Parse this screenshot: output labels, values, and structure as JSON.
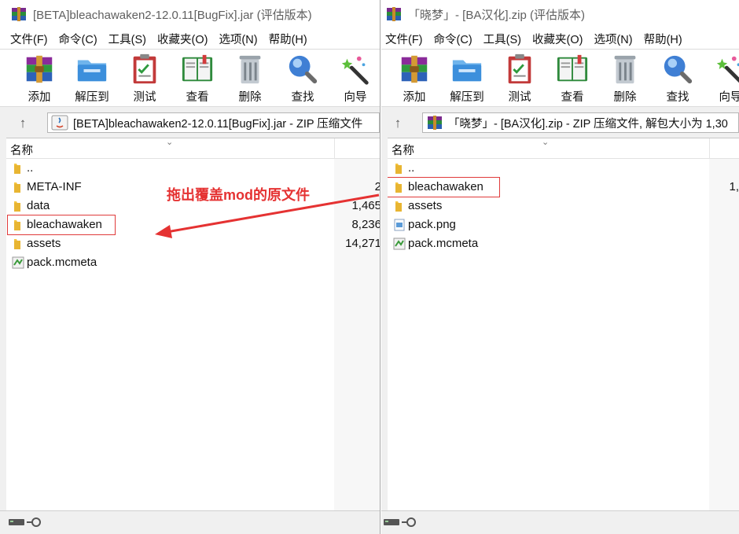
{
  "left": {
    "title": "[BETA]bleachawaken2-12.0.11[BugFix].jar (评估版本)",
    "menu": [
      "文件(F)",
      "命令(C)",
      "工具(S)",
      "收藏夹(O)",
      "选项(N)",
      "帮助(H)"
    ],
    "toolbar": [
      {
        "label": "添加",
        "icon": "add-archive-icon"
      },
      {
        "label": "解压到",
        "icon": "extract-folder-icon"
      },
      {
        "label": "测试",
        "icon": "test-clipboard-icon"
      },
      {
        "label": "查看",
        "icon": "view-book-icon"
      },
      {
        "label": "删除",
        "icon": "trash-can-icon"
      },
      {
        "label": "查找",
        "icon": "magnifier-icon"
      },
      {
        "label": "向导",
        "icon": "wizard-wand-icon"
      }
    ],
    "address": "[BETA]bleachawaken2-12.0.11[BugFix].jar - ZIP 压缩文件",
    "column_name": "名称",
    "files": [
      {
        "name": "..",
        "size": "",
        "icon": "folder-icon"
      },
      {
        "name": "META-INF",
        "size": "2",
        "icon": "folder-icon"
      },
      {
        "name": "data",
        "size": "1,465",
        "icon": "folder-icon"
      },
      {
        "name": "bleachawaken",
        "size": "8,236",
        "icon": "folder-icon"
      },
      {
        "name": "assets",
        "size": "14,271",
        "icon": "folder-icon"
      },
      {
        "name": "pack.mcmeta",
        "size": "",
        "icon": "mcmeta-file-icon"
      }
    ]
  },
  "right": {
    "title": "「晓梦」- [BA汉化].zip (评估版本)",
    "menu": [
      "文件(F)",
      "命令(C)",
      "工具(S)",
      "收藏夹(O)",
      "选项(N)",
      "帮助(H)"
    ],
    "toolbar": [
      {
        "label": "添加",
        "icon": "add-archive-icon"
      },
      {
        "label": "解压到",
        "icon": "extract-folder-icon"
      },
      {
        "label": "测试",
        "icon": "test-clipboard-icon"
      },
      {
        "label": "查看",
        "icon": "view-book-icon"
      },
      {
        "label": "删除",
        "icon": "trash-can-icon"
      },
      {
        "label": "查找",
        "icon": "magnifier-icon"
      },
      {
        "label": "向导",
        "icon": "wizard-wand-icon"
      }
    ],
    "address": "「晓梦」- [BA汉化].zip - ZIP 压缩文件, 解包大小为 1,30",
    "column_name": "名称",
    "files": [
      {
        "name": "..",
        "size": "",
        "icon": "folder-icon"
      },
      {
        "name": "bleachawaken",
        "size": "1,",
        "icon": "folder-icon"
      },
      {
        "name": "assets",
        "size": "",
        "icon": "folder-icon"
      },
      {
        "name": "pack.png",
        "size": "",
        "icon": "png-file-icon"
      },
      {
        "name": "pack.mcmeta",
        "size": "",
        "icon": "mcmeta-file-icon"
      }
    ]
  },
  "annotation": {
    "text": "拖出覆盖mod的原文件",
    "color": "#e53232"
  },
  "colors": {
    "highlight": "#e03a3a",
    "folder": "#f5c542",
    "window_bg": "#f0f0f0"
  }
}
